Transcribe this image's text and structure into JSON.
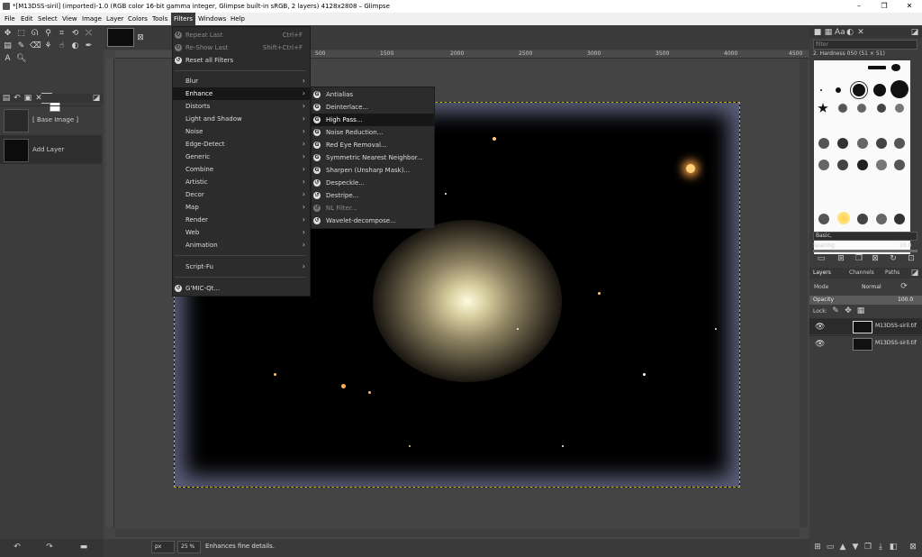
{
  "window": {
    "title": "*[M13DSS-siril] (imported)-1.0 (RGB color 16-bit gamma integer, Glimpse built-in sRGB, 2 layers) 4128x2808 – Glimpse",
    "minimize": "–",
    "maximize": "❐",
    "close": "✕"
  },
  "menubar": [
    "File",
    "Edit",
    "Select",
    "View",
    "Image",
    "Layer",
    "Colors",
    "Tools",
    "Filters",
    "Windows",
    "Help"
  ],
  "filters_menu": {
    "items": [
      {
        "label": "Repeat Last",
        "accel": "Ctrl+F",
        "disabled": true
      },
      {
        "label": "Re-Show Last",
        "accel": "Shift+Ctrl+F",
        "disabled": true
      },
      {
        "label": "Reset all Filters",
        "accel": "",
        "disabled": false
      },
      {
        "label": "Blur"
      },
      {
        "label": "Enhance"
      },
      {
        "label": "Distorts"
      },
      {
        "label": "Light and Shadow"
      },
      {
        "label": "Noise"
      },
      {
        "label": "Edge-Detect"
      },
      {
        "label": "Generic"
      },
      {
        "label": "Combine"
      },
      {
        "label": "Artistic"
      },
      {
        "label": "Decor"
      },
      {
        "label": "Map"
      },
      {
        "label": "Render"
      },
      {
        "label": "Web"
      },
      {
        "label": "Animation"
      },
      {
        "label": "Script-Fu"
      },
      {
        "label": "G'MIC-Qt..."
      }
    ]
  },
  "enhance_menu": {
    "items": [
      {
        "label": "Antialias"
      },
      {
        "label": "Deinterlace..."
      },
      {
        "label": "High Pass..."
      },
      {
        "label": "Noise Reduction..."
      },
      {
        "label": "Red Eye Removal..."
      },
      {
        "label": "Symmetric Nearest Neighbor..."
      },
      {
        "label": "Sharpen (Unsharp Mask)..."
      },
      {
        "label": "Despeckle..."
      },
      {
        "label": "Destripe..."
      },
      {
        "label": "NL Filter..."
      },
      {
        "label": "Wavelet-decompose..."
      }
    ]
  },
  "toolbox": {
    "images": [
      {
        "label": "[ Base Image ]"
      },
      {
        "label": "Add Layer"
      }
    ]
  },
  "ruler": {
    "labels": [
      "500",
      "1500",
      "2000",
      "2500",
      "3000",
      "3500",
      "4000",
      "4500"
    ]
  },
  "statusbar": {
    "unit": "px",
    "zoom": "25 %",
    "message": "Enhances fine details."
  },
  "brushes": {
    "filter_placeholder": "filter",
    "title": "2. Hardness 050 (51 × 51)",
    "preset": "Basic,",
    "spacing_label": "Spacing",
    "spacing_value": "10.0"
  },
  "layers": {
    "tabs": [
      "Layers",
      "Channels",
      "Paths"
    ],
    "mode_label": "Mode",
    "mode_value": "Normal",
    "opacity_label": "Opacity",
    "opacity_value": "100.0",
    "lock_label": "Lock:",
    "items": [
      {
        "name": "M13DSS-siril.tif"
      },
      {
        "name": "M13DSS-siril.tif"
      }
    ]
  },
  "colors": {
    "menu_bg": "#2c2c2c",
    "highlight": "#171717",
    "selection_border": "#b8b000"
  }
}
